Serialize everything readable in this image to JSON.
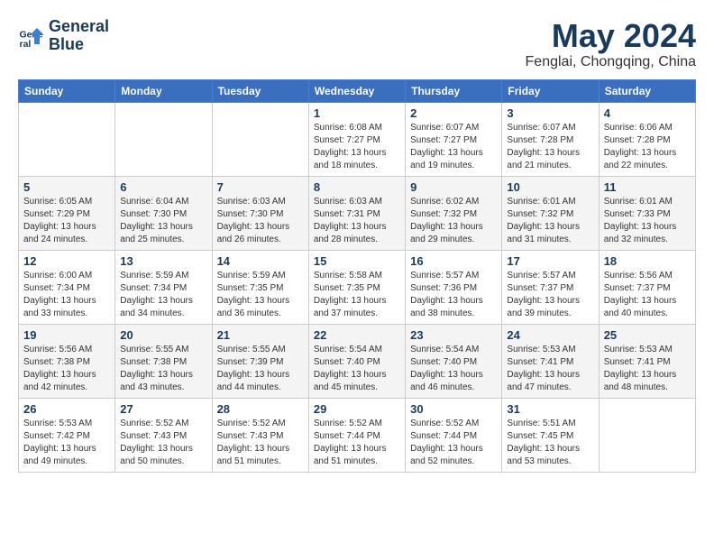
{
  "header": {
    "logo_line1": "General",
    "logo_line2": "Blue",
    "month": "May 2024",
    "location": "Fenglai, Chongqing, China"
  },
  "weekdays": [
    "Sunday",
    "Monday",
    "Tuesday",
    "Wednesday",
    "Thursday",
    "Friday",
    "Saturday"
  ],
  "weeks": [
    [
      {
        "day": "",
        "info": ""
      },
      {
        "day": "",
        "info": ""
      },
      {
        "day": "",
        "info": ""
      },
      {
        "day": "1",
        "info": "Sunrise: 6:08 AM\nSunset: 7:27 PM\nDaylight: 13 hours and 18 minutes."
      },
      {
        "day": "2",
        "info": "Sunrise: 6:07 AM\nSunset: 7:27 PM\nDaylight: 13 hours and 19 minutes."
      },
      {
        "day": "3",
        "info": "Sunrise: 6:07 AM\nSunset: 7:28 PM\nDaylight: 13 hours and 21 minutes."
      },
      {
        "day": "4",
        "info": "Sunrise: 6:06 AM\nSunset: 7:28 PM\nDaylight: 13 hours and 22 minutes."
      }
    ],
    [
      {
        "day": "5",
        "info": "Sunrise: 6:05 AM\nSunset: 7:29 PM\nDaylight: 13 hours and 24 minutes."
      },
      {
        "day": "6",
        "info": "Sunrise: 6:04 AM\nSunset: 7:30 PM\nDaylight: 13 hours and 25 minutes."
      },
      {
        "day": "7",
        "info": "Sunrise: 6:03 AM\nSunset: 7:30 PM\nDaylight: 13 hours and 26 minutes."
      },
      {
        "day": "8",
        "info": "Sunrise: 6:03 AM\nSunset: 7:31 PM\nDaylight: 13 hours and 28 minutes."
      },
      {
        "day": "9",
        "info": "Sunrise: 6:02 AM\nSunset: 7:32 PM\nDaylight: 13 hours and 29 minutes."
      },
      {
        "day": "10",
        "info": "Sunrise: 6:01 AM\nSunset: 7:32 PM\nDaylight: 13 hours and 31 minutes."
      },
      {
        "day": "11",
        "info": "Sunrise: 6:01 AM\nSunset: 7:33 PM\nDaylight: 13 hours and 32 minutes."
      }
    ],
    [
      {
        "day": "12",
        "info": "Sunrise: 6:00 AM\nSunset: 7:34 PM\nDaylight: 13 hours and 33 minutes."
      },
      {
        "day": "13",
        "info": "Sunrise: 5:59 AM\nSunset: 7:34 PM\nDaylight: 13 hours and 34 minutes."
      },
      {
        "day": "14",
        "info": "Sunrise: 5:59 AM\nSunset: 7:35 PM\nDaylight: 13 hours and 36 minutes."
      },
      {
        "day": "15",
        "info": "Sunrise: 5:58 AM\nSunset: 7:35 PM\nDaylight: 13 hours and 37 minutes."
      },
      {
        "day": "16",
        "info": "Sunrise: 5:57 AM\nSunset: 7:36 PM\nDaylight: 13 hours and 38 minutes."
      },
      {
        "day": "17",
        "info": "Sunrise: 5:57 AM\nSunset: 7:37 PM\nDaylight: 13 hours and 39 minutes."
      },
      {
        "day": "18",
        "info": "Sunrise: 5:56 AM\nSunset: 7:37 PM\nDaylight: 13 hours and 40 minutes."
      }
    ],
    [
      {
        "day": "19",
        "info": "Sunrise: 5:56 AM\nSunset: 7:38 PM\nDaylight: 13 hours and 42 minutes."
      },
      {
        "day": "20",
        "info": "Sunrise: 5:55 AM\nSunset: 7:38 PM\nDaylight: 13 hours and 43 minutes."
      },
      {
        "day": "21",
        "info": "Sunrise: 5:55 AM\nSunset: 7:39 PM\nDaylight: 13 hours and 44 minutes."
      },
      {
        "day": "22",
        "info": "Sunrise: 5:54 AM\nSunset: 7:40 PM\nDaylight: 13 hours and 45 minutes."
      },
      {
        "day": "23",
        "info": "Sunrise: 5:54 AM\nSunset: 7:40 PM\nDaylight: 13 hours and 46 minutes."
      },
      {
        "day": "24",
        "info": "Sunrise: 5:53 AM\nSunset: 7:41 PM\nDaylight: 13 hours and 47 minutes."
      },
      {
        "day": "25",
        "info": "Sunrise: 5:53 AM\nSunset: 7:41 PM\nDaylight: 13 hours and 48 minutes."
      }
    ],
    [
      {
        "day": "26",
        "info": "Sunrise: 5:53 AM\nSunset: 7:42 PM\nDaylight: 13 hours and 49 minutes."
      },
      {
        "day": "27",
        "info": "Sunrise: 5:52 AM\nSunset: 7:43 PM\nDaylight: 13 hours and 50 minutes."
      },
      {
        "day": "28",
        "info": "Sunrise: 5:52 AM\nSunset: 7:43 PM\nDaylight: 13 hours and 51 minutes."
      },
      {
        "day": "29",
        "info": "Sunrise: 5:52 AM\nSunset: 7:44 PM\nDaylight: 13 hours and 51 minutes."
      },
      {
        "day": "30",
        "info": "Sunrise: 5:52 AM\nSunset: 7:44 PM\nDaylight: 13 hours and 52 minutes."
      },
      {
        "day": "31",
        "info": "Sunrise: 5:51 AM\nSunset: 7:45 PM\nDaylight: 13 hours and 53 minutes."
      },
      {
        "day": "",
        "info": ""
      }
    ]
  ]
}
